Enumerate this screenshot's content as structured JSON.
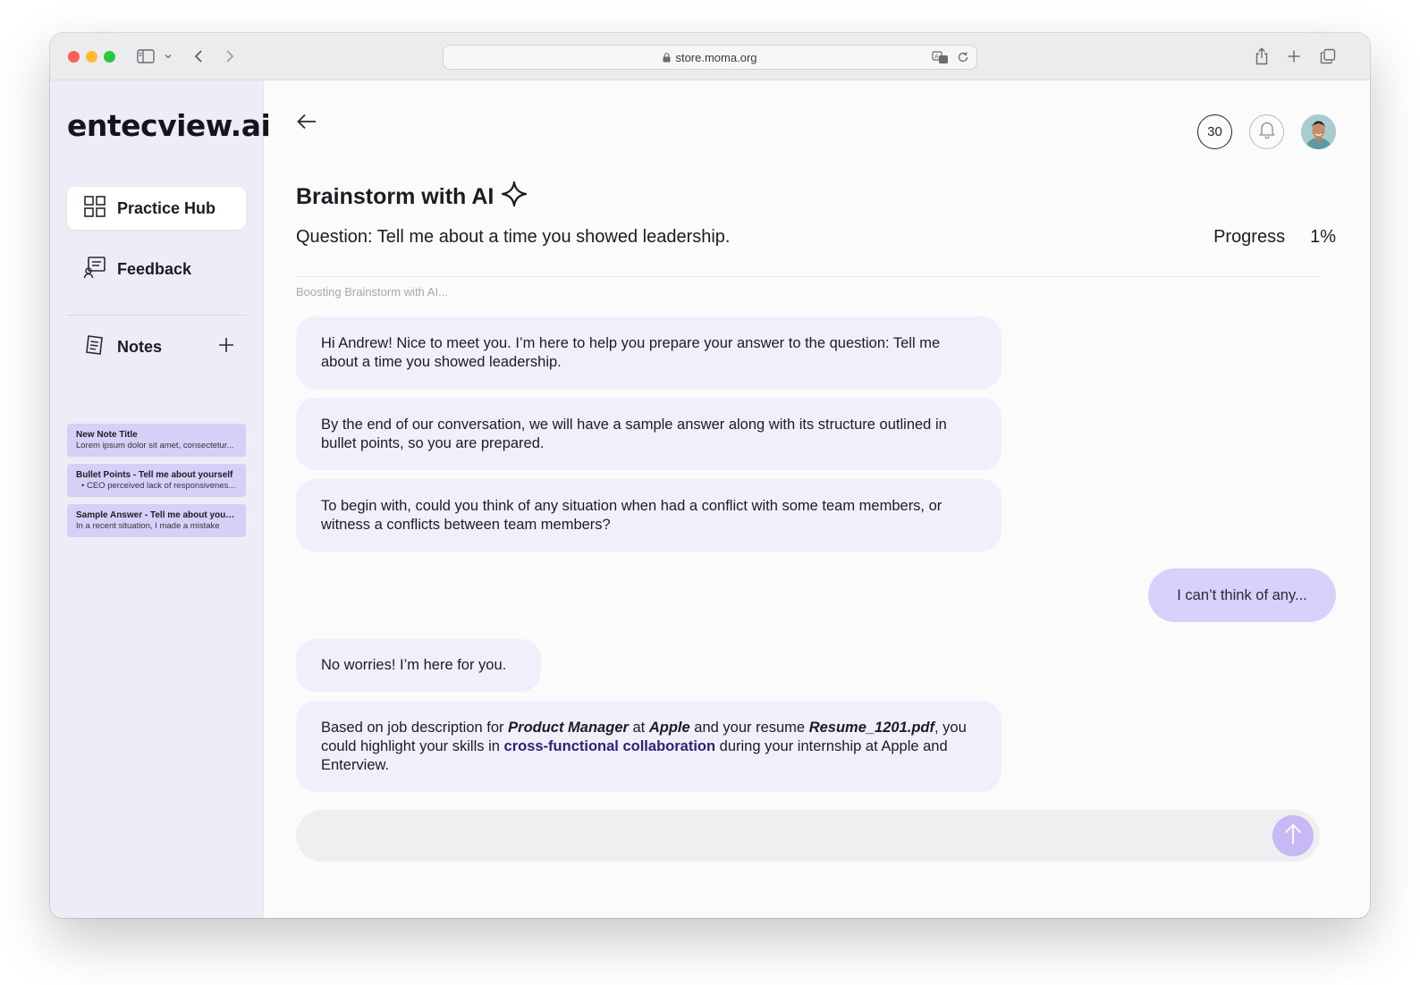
{
  "browser": {
    "url": "store.moma.org"
  },
  "sidebar": {
    "logo": "entecview.ai",
    "nav": [
      {
        "label": "Practice Hub",
        "icon": "grid-icon",
        "active": true
      },
      {
        "label": "Feedback",
        "icon": "feedback-icon",
        "active": false
      }
    ],
    "notes_label": "Notes",
    "notes": [
      {
        "title": "New Note Title",
        "preview": "Lorem ipsum dolor sit amet, consectetur..."
      },
      {
        "title": "Bullet Points - Tell me about yourself",
        "preview": "•  CEO perceived lack of responsivenes..."
      },
      {
        "title": "Sample Answer - Tell me about yourself",
        "preview": "In a recent situation, I made a mistake"
      }
    ]
  },
  "header": {
    "credits": "30",
    "title": "Brainstorm with AI",
    "question": "Question: Tell me about a time you showed leadership.",
    "progress_label": "Progress",
    "progress_value": "1%"
  },
  "chat": {
    "status": "Boosting Brainstorm with AI...",
    "messages": [
      {
        "role": "ai",
        "text": "Hi Andrew! Nice to meet you. I’m here to help you prepare your answer to the question: Tell me about a time you showed leadership."
      },
      {
        "role": "ai",
        "text": "By the end of our conversation, we will have a sample answer along with its structure outlined in bullet points, so you are prepared."
      },
      {
        "role": "ai",
        "text": "To begin with, could you think of any situation when had a conflict with some team members, or witness a conflicts between team members?"
      },
      {
        "role": "user",
        "text": "I can’t think of any..."
      },
      {
        "role": "ai",
        "text": "No worries! I’m here for you."
      },
      {
        "role": "ai",
        "parts": {
          "t1": "Based on job description for ",
          "role_name": "Product Manager",
          "t2": " at ",
          "company": "Apple",
          "t3": " and your resume ",
          "resume": "Resume_1201.pdf",
          "t4": ", you could highlight your skills in ",
          "skill": "cross-functional collaboration",
          "t5": " during your internship at Apple and Enterview."
        }
      }
    ],
    "input_placeholder": ""
  },
  "colors": {
    "accent": "#c7b8f6",
    "ai_bubble": "#f1effc",
    "user_bubble": "#d9d0fb",
    "sidebar_bg": "#eeedf7",
    "note_card": "#d6cff8",
    "highlight": "#2a2573"
  }
}
